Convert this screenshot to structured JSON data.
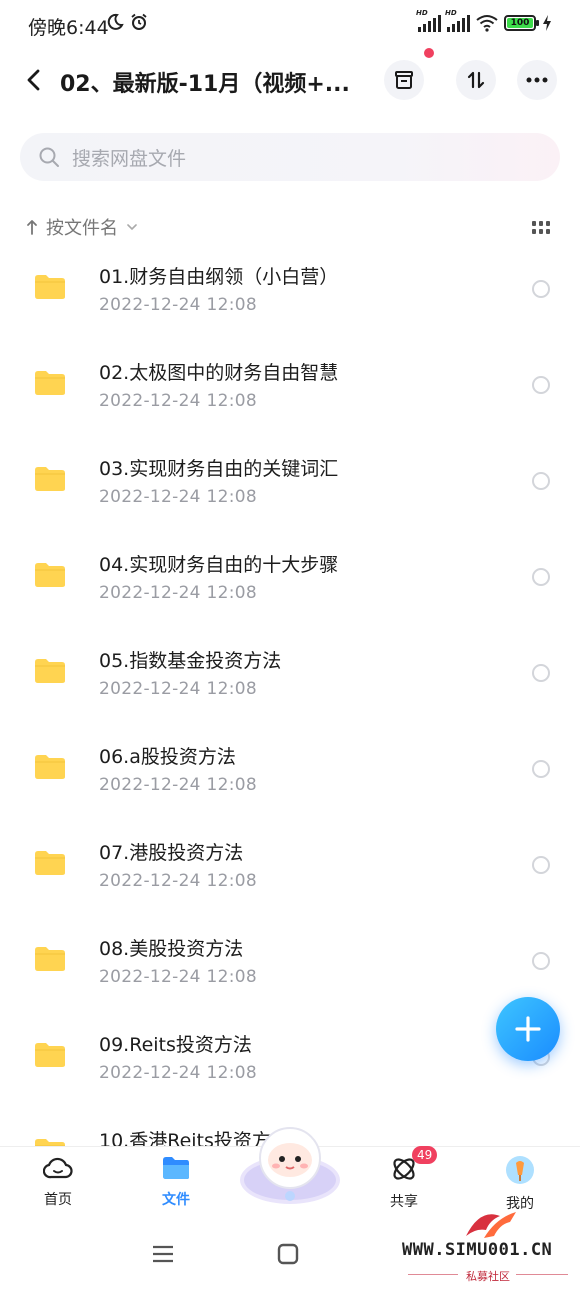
{
  "status_bar": {
    "time": "傍晚6:44",
    "battery": "100"
  },
  "header": {
    "title": "02、最新版-11月（视频+...",
    "back_icon": "chevron-left-icon",
    "actions": [
      "archive-icon",
      "transfer-icon",
      "more-icon"
    ]
  },
  "search": {
    "placeholder": "搜索网盘文件"
  },
  "sort": {
    "label": "按文件名"
  },
  "files": [
    {
      "name": "01.财务自由纲领（小白营）",
      "date": "2022-12-24  12:08"
    },
    {
      "name": "02.太极图中的财务自由智慧",
      "date": "2022-12-24  12:08"
    },
    {
      "name": "03.实现财务自由的关键词汇",
      "date": "2022-12-24  12:08"
    },
    {
      "name": "04.实现财务自由的十大步骤",
      "date": "2022-12-24  12:08"
    },
    {
      "name": "05.指数基金投资方法",
      "date": "2022-12-24  12:08"
    },
    {
      "name": "06.a股投资方法",
      "date": "2022-12-24  12:08"
    },
    {
      "name": "07.港股投资方法",
      "date": "2022-12-24  12:08"
    },
    {
      "name": "08.美股投资方法",
      "date": "2022-12-24  12:08"
    },
    {
      "name": "09.Reits投资方法",
      "date": "2022-12-24  12:08"
    },
    {
      "name": "10.香港Reits投资方",
      "date": ""
    }
  ],
  "bottom_nav": {
    "home": "首页",
    "files": "文件",
    "share": "共享",
    "mine": "我的",
    "share_badge": "49"
  },
  "watermark": {
    "text": "WWW.SIMU001.CN",
    "sub": "私募社区"
  },
  "colors": {
    "accent": "#2f8cff",
    "folder": "#ffd451",
    "badge": "#f0405f"
  }
}
